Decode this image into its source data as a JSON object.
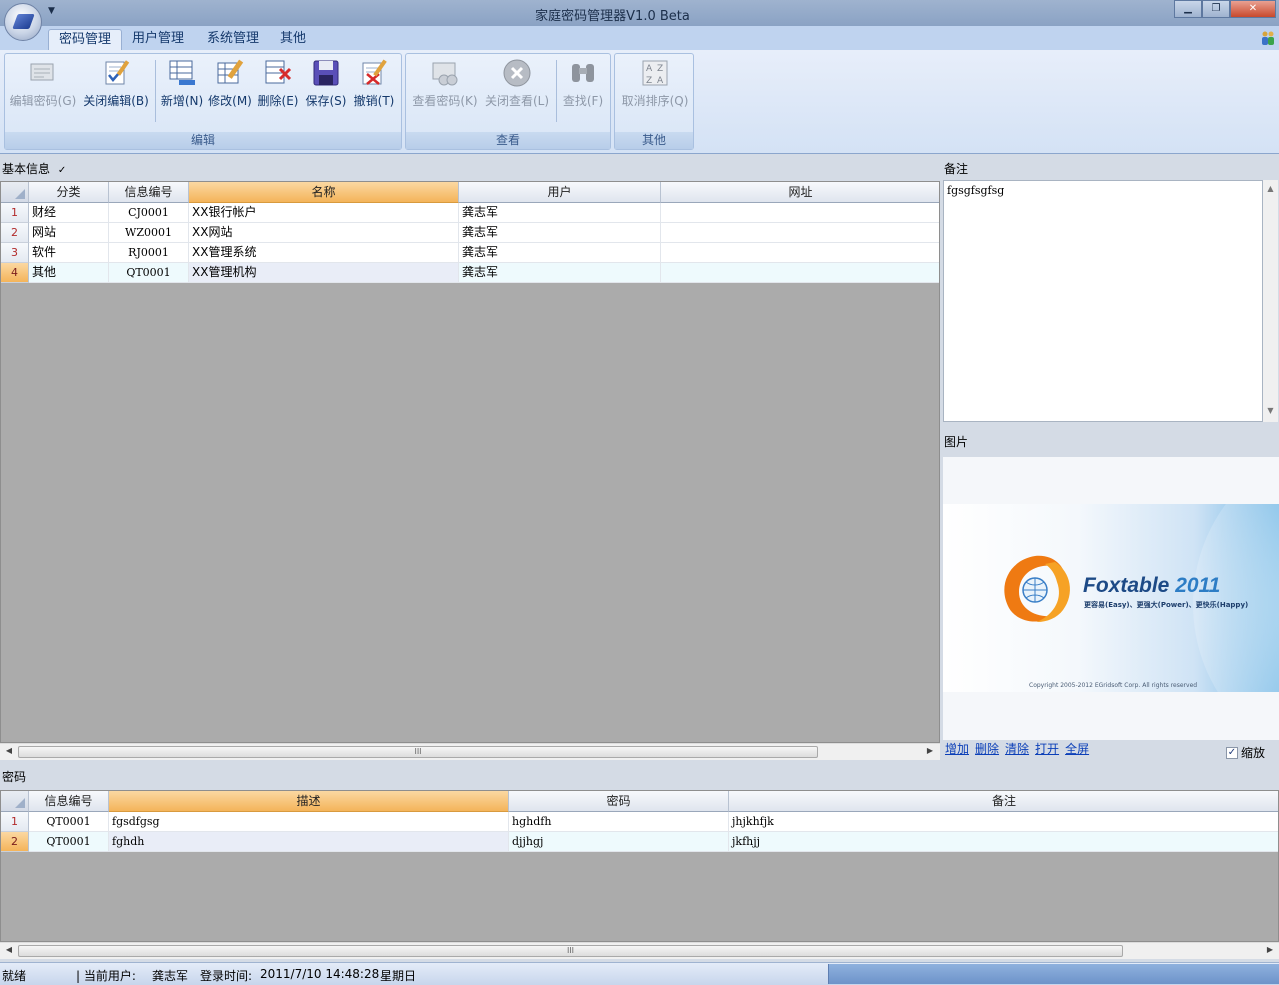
{
  "window": {
    "title": "家庭密码管理器V1.0 Beta",
    "minimize": "▁",
    "maximize": "❐",
    "close": "✕"
  },
  "tabs": [
    {
      "label": "密码管理",
      "active": true
    },
    {
      "label": "用户管理"
    },
    {
      "label": "系统管理"
    },
    {
      "label": "其他"
    }
  ],
  "ribbon": {
    "groups": [
      {
        "label": "编辑"
      },
      {
        "label": "查看"
      },
      {
        "label": "其他"
      }
    ],
    "buttons": {
      "edit_password": "编辑密码(G)",
      "close_edit": "关闭编辑(B)",
      "add": "新增(N)",
      "modify": "修改(M)",
      "delete": "删除(E)",
      "save": "保存(S)",
      "undo": "撤销(T)",
      "view_password": "查看密码(K)",
      "close_view": "关闭查看(L)",
      "find": "查找(F)",
      "cancel_sort": "取消排序(Q)"
    }
  },
  "basic_info": {
    "label": "基本信息",
    "edit_mark": "✓",
    "columns": [
      "分类",
      "信息编号",
      "名称",
      "用户",
      "网址"
    ],
    "rows": [
      {
        "n": "1",
        "cat": "财经",
        "id": "CJ0001",
        "name": "XX银行帐户",
        "user": "龚志军",
        "url": ""
      },
      {
        "n": "2",
        "cat": "网站",
        "id": "WZ0001",
        "name": "XX网站",
        "user": "龚志军",
        "url": ""
      },
      {
        "n": "3",
        "cat": "软件",
        "id": "RJ0001",
        "name": "XX管理系统",
        "user": "龚志军",
        "url": ""
      },
      {
        "n": "4",
        "cat": "其他",
        "id": "QT0001",
        "name": "XX管理机构",
        "user": "龚志军",
        "url": ""
      }
    ]
  },
  "remarks": {
    "label": "备注",
    "text": "fgsgfsgfsg"
  },
  "picture": {
    "label": "图片",
    "brand": "Foxtable",
    "year": "2011",
    "slogan": "更容易(Easy)、更强大(Power)、更快乐(Happy)",
    "copyright": "Copyright 2005-2012 EGridsoft Corp. All rights reserved"
  },
  "pic_links": [
    "增加",
    "删除",
    "清除",
    "打开",
    "全屏"
  ],
  "zoom_label": "缩放",
  "zoom_checked": "✓",
  "passwords": {
    "label": "密码",
    "columns": [
      "信息编号",
      "描述",
      "密码",
      "备注"
    ],
    "rows": [
      {
        "n": "1",
        "id": "QT0001",
        "desc": "fgsdfgsg",
        "pwd": "hghdfh",
        "note": "jhjkhfjk"
      },
      {
        "n": "2",
        "id": "QT0001",
        "desc": "fghdh",
        "pwd": "djjhgj",
        "note": "jkfhjj"
      }
    ]
  },
  "scroll": {
    "left": "◀",
    "right": "▶",
    "up": "▲",
    "down": "▼",
    "grip": "III"
  },
  "status": {
    "ready": "就绪",
    "current_user_label": "| 当前用户:",
    "current_user": "龚志军",
    "login_label": "登录时间:",
    "login_time": "2011/7/10 14:48:28",
    "weekday": "星期日"
  },
  "colors": {
    "accent": "#f4b45a",
    "ribbon": "#d4e2f5",
    "link": "#0b3fb8"
  }
}
